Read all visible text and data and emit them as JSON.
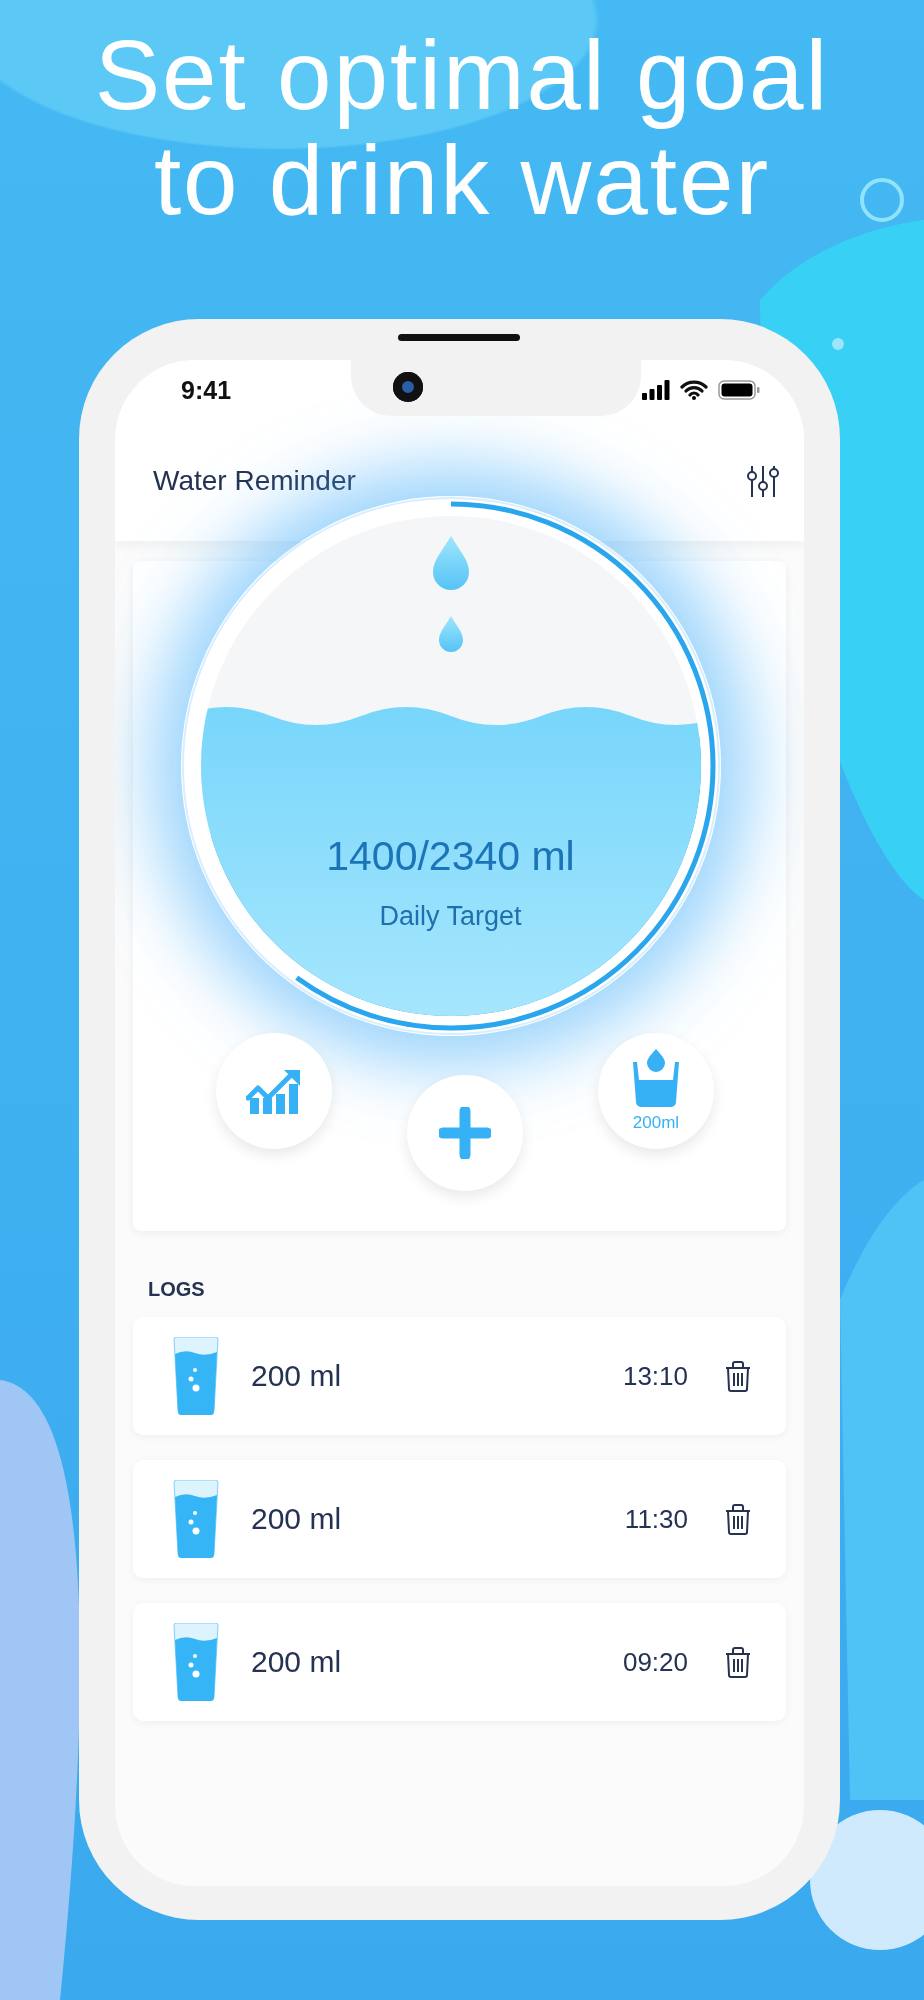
{
  "headline": "Set optimal goal to drink water",
  "status_bar": {
    "time": "9:41"
  },
  "app_bar": {
    "title": "Water Reminder"
  },
  "gauge": {
    "amount": "1400/2340 ml",
    "label": "Daily Target",
    "level": 0.6
  },
  "actions": [
    {
      "kind": "stats"
    },
    {
      "kind": "add"
    },
    {
      "kind": "cup",
      "label": "200ml"
    }
  ],
  "logs": {
    "heading": "LOGS",
    "entries": [
      {
        "amount": "200 ml",
        "time": "13:10"
      },
      {
        "amount": "200 ml",
        "time": "11:30"
      },
      {
        "amount": "200 ml",
        "time": "09:20"
      }
    ]
  }
}
